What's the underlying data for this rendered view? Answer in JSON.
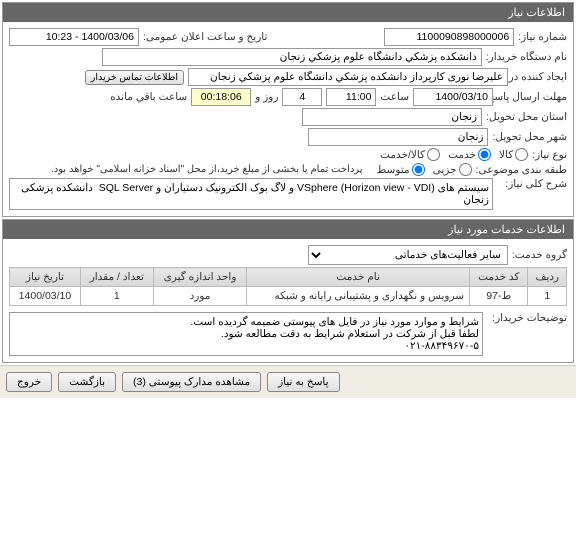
{
  "header": {
    "title": "اطلاعات نیاز"
  },
  "fields": {
    "request_number": {
      "label": "شماره نیاز:",
      "value": "1100090898000006"
    },
    "public_announce": {
      "label": "تاریخ و ساعت اعلان عمومی:",
      "value": "1400/03/06 - 10:23"
    },
    "buyer_org": {
      "label": "نام دستگاه خریدار:",
      "value": "دانشکده پزشکي دانشگاه علوم پزشکي زنجان"
    },
    "creator": {
      "label": "ایجاد کننده درخواست:",
      "value": "علیرضا نوری کارپرداز دانشکده پزشکي دانشگاه علوم پزشکي زنجان"
    },
    "contact_btn": "اطلاعات تماس خریدار",
    "deadline": {
      "label": "مهلت ارسال پاسخ:",
      "value": "1400/03/10",
      "time_label": "ساعت",
      "time": "11:00",
      "days_label": "روز و",
      "days": "4",
      "remaining": "00:18:06",
      "remaining_label": "ساعت باقي مانده"
    },
    "province": {
      "label": "استان محل تحویل:",
      "value": "زنجان"
    },
    "city": {
      "label": "شهر محل تحویل:",
      "value": "زنجان"
    },
    "need_type": {
      "label": "نوع نیاز:",
      "options": [
        "کالا",
        "خدمت",
        "کالا/خدمت"
      ],
      "selected": 1
    },
    "purchase_type": {
      "label": "طبقه بندی موضوعی:",
      "options": [
        "جزیی",
        "متوسط"
      ],
      "selected": 1,
      "note": "پرداخت تمام یا بخشی از مبلغ خرید،از محل \"اسناد خزانه اسلامی\" خواهد بود."
    },
    "description": {
      "label": "شرح کلی نیاز:",
      "value": "سیستم های VSphere (Horizon view - VDI) و لاگ بوک الکترونیک دستیاران و SQL Server  دانشکده پزشکی زنجان"
    }
  },
  "services": {
    "header": "اطلاعات خدمات مورد نیاز",
    "group_label": "گروه خدمت:",
    "group_value": "سایر فعالیت‌های خدماتی",
    "columns": [
      "ردیف",
      "کد خدمت",
      "نام خدمت",
      "واحد اندازه گیری",
      "تعداد / مقدار",
      "تاریخ نیاز"
    ],
    "rows": [
      {
        "idx": "1",
        "code": "ط-97",
        "name": "سرویس و نگهداری و پشتیبانی رایانه و شبکه",
        "unit": "مورد",
        "qty": "1",
        "date": "1400/03/10"
      }
    ]
  },
  "notes": {
    "label": "توضیحات خریدار:",
    "value": "شرایط و موارد مورد نیاز در فایل های پیوستی ضمیمه گردیده است.\nلطفا قبل از شرکت در استعلام شرایط به دقت مطالعه شود.\n۰۲۱-۸۸۳۴۹۶۷۰-۵"
  },
  "footer": {
    "reply": "پاسخ به نیاز",
    "attachments": "مشاهده مدارک پیوستی (3)",
    "back": "بازگشت",
    "exit": "خروج"
  }
}
